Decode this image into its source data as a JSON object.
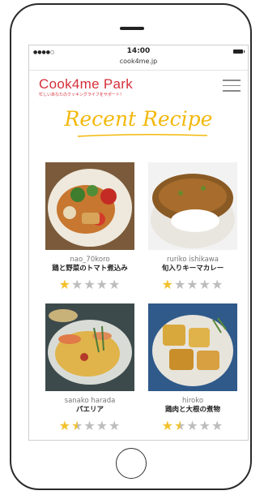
{
  "status": {
    "time": "14:00"
  },
  "browser": {
    "url": "cook4me.jp"
  },
  "header": {
    "logo": "Cook4me Park",
    "tagline": "忙しいあなたのクッキングライフをサポート！"
  },
  "section": {
    "title": "Recent Recipe"
  },
  "recipes": [
    {
      "author": "nao_70koro",
      "title": "鶏と野菜のトマト煮込み",
      "rating": 1,
      "max": 5
    },
    {
      "author": "ruriko ishikawa",
      "title": "旬入りキーマカレー",
      "rating": 1,
      "max": 5
    },
    {
      "author": "sanako harada",
      "title": "パエリア",
      "rating": 1.5,
      "max": 5
    },
    {
      "author": "hiroko",
      "title": "鶏肉と大根の煮物",
      "rating": 1.5,
      "max": 5
    }
  ],
  "colors": {
    "brand": "#d62f3a",
    "accent": "#f2b80a"
  }
}
